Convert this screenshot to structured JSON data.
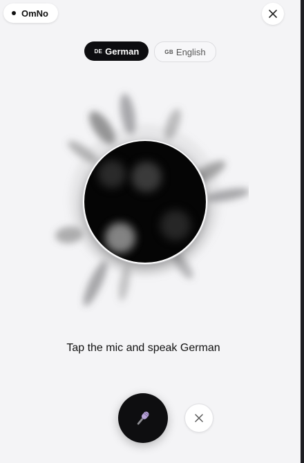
{
  "brand": {
    "name": "OmNo"
  },
  "languages": [
    {
      "code": "DE",
      "label": "German",
      "active": true
    },
    {
      "code": "GB",
      "label": "English",
      "active": false
    }
  ],
  "prompt": "Tap the mic and speak German",
  "icons": {
    "close_top": "close-icon",
    "mic": "microphone-icon",
    "cancel": "close-icon"
  },
  "colors": {
    "background": "#f4f4f6",
    "active_pill": "#0d0d10",
    "mic_accent": "#b7a3d6"
  }
}
